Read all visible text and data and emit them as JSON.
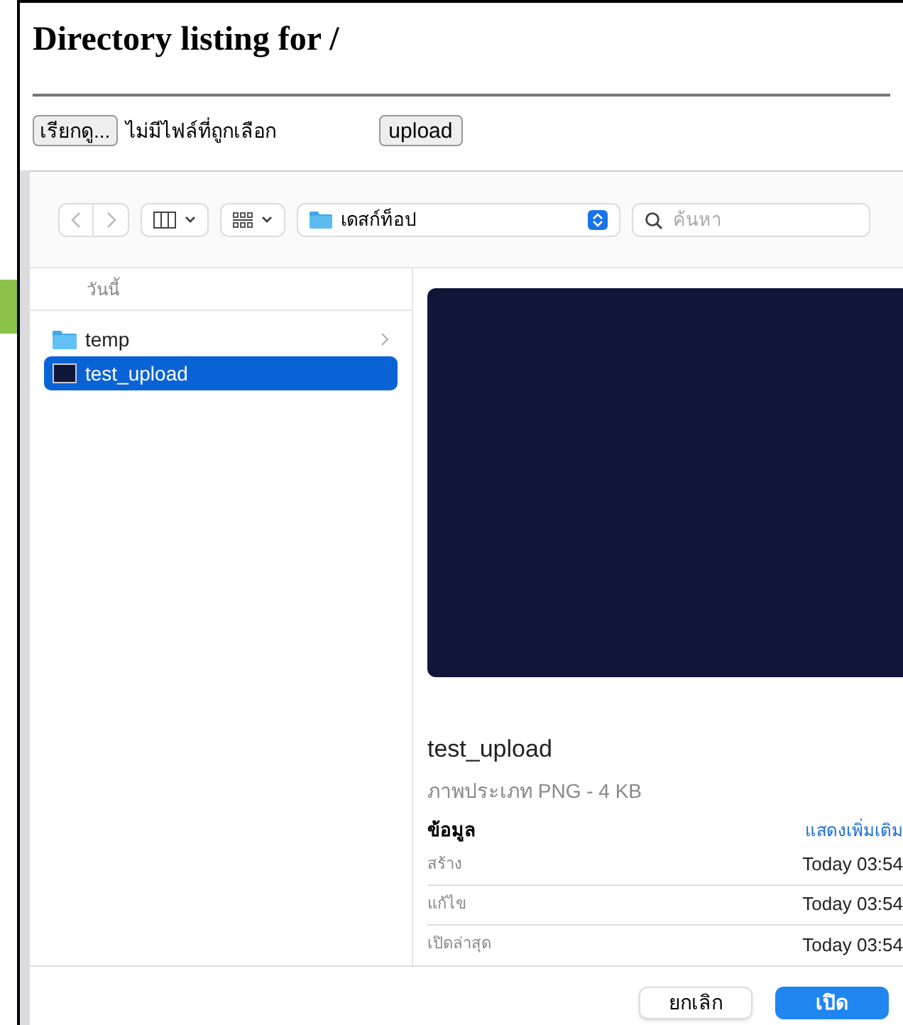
{
  "page": {
    "title": "Directory listing for /",
    "file_button": "เรียกดู...",
    "file_status": "ไม่มีไฟล์ที่ถูกเลือก",
    "upload_button": "upload"
  },
  "dialog": {
    "location": "เดสก์ท็อป",
    "search": {
      "placeholder": "ค้นหา"
    },
    "section": "วันนี้",
    "files": [
      {
        "name": "temp",
        "kind": "folder",
        "selected": false
      },
      {
        "name": "test_upload",
        "kind": "image",
        "selected": true
      }
    ],
    "preview": {
      "name": "test_upload",
      "type": "ภาพประเภท PNG - 4 KB",
      "info_heading": "ข้อมูล",
      "more_link": "แสดงเพิ่มเติม",
      "rows": [
        {
          "label": "สร้าง",
          "value": "Today 03:54"
        },
        {
          "label": "แก้ไข",
          "value": "Today 03:54"
        },
        {
          "label": "เปิดล่าสุด",
          "value": "Today 03:54"
        }
      ]
    },
    "cancel_button": "ยกเลิก",
    "open_button": "เปิด"
  }
}
